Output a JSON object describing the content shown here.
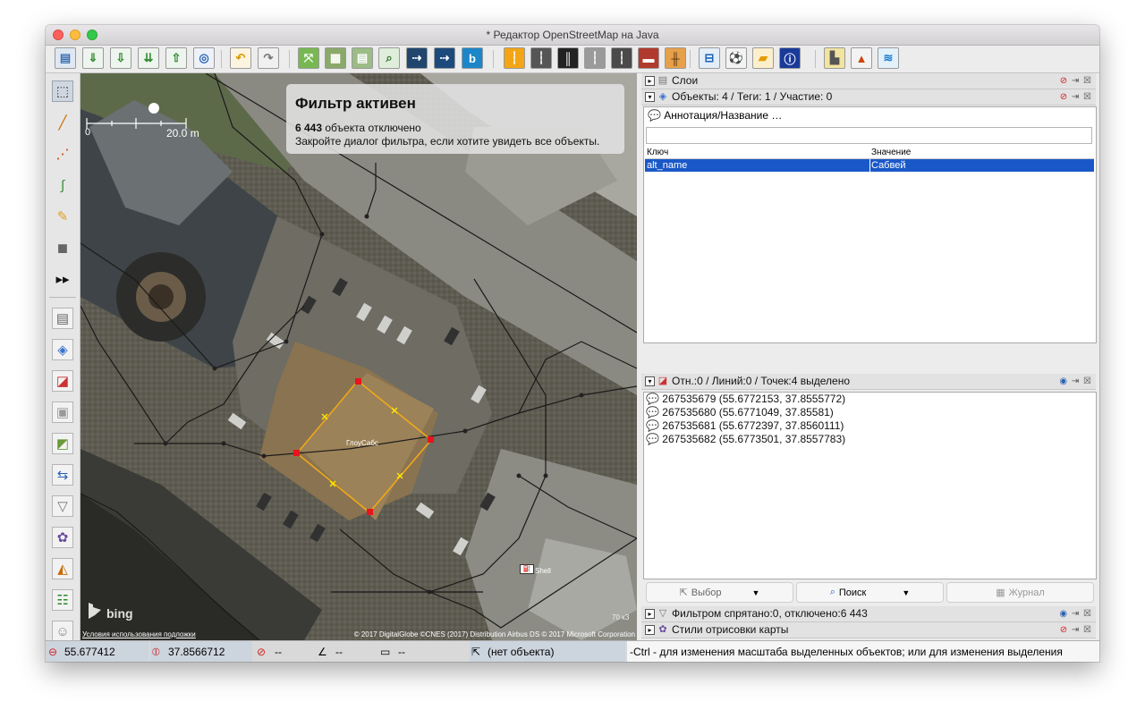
{
  "window": {
    "title": "* Редактор OpenStreetMap на Java"
  },
  "toolbar": {
    "buttons": [
      {
        "icon": "open-file-icon",
        "glyph": "▤",
        "color": "#3b6fb0",
        "bg": "#dfe8f2"
      },
      {
        "icon": "save-icon",
        "glyph": "⇓",
        "color": "#2f8a2f",
        "bg": "#eef4ee"
      },
      {
        "icon": "download-icon",
        "glyph": "⇩",
        "color": "#2f8a2f",
        "bg": "#eef4ee"
      },
      {
        "icon": "download-area-icon",
        "glyph": "⇊",
        "color": "#2f8a2f",
        "bg": "#eef4ee"
      },
      {
        "icon": "upload-icon",
        "glyph": "⇧",
        "color": "#2f8a2f",
        "bg": "#eef4ee"
      },
      {
        "icon": "globe-icon",
        "glyph": "◎",
        "color": "#2a65b8",
        "bg": "#eef2f8"
      },
      {
        "icon": "undo-icon",
        "glyph": "↶",
        "color": "#d89a00",
        "bg": "#fbf4e0"
      },
      {
        "icon": "redo-icon",
        "glyph": "↷",
        "color": "#777777",
        "bg": "#f0f0f0"
      },
      {
        "icon": "zoom-to-selection-icon",
        "glyph": "⤧",
        "color": "#ffffff",
        "bg": "#78b852"
      },
      {
        "icon": "zoom-to-layer-icon",
        "glyph": "▦",
        "color": "#ffffff",
        "bg": "#8aa96a"
      },
      {
        "icon": "wms-icon",
        "glyph": "▤",
        "color": "#ffffff",
        "bg": "#9cbc86"
      },
      {
        "icon": "search-icon",
        "glyph": "⌕",
        "color": "#2f6d2f",
        "bg": "#dfeedb"
      },
      {
        "icon": "layer-motorway-icon",
        "glyph": "⇢",
        "color": "#ffffff",
        "bg": "#20466e"
      },
      {
        "icon": "layer-trunk-icon",
        "glyph": "⇢",
        "color": "#ffffff",
        "bg": "#1d4a7c"
      },
      {
        "icon": "bing-icon",
        "glyph": "b",
        "color": "#ffffff",
        "bg": "#1c86c9"
      },
      {
        "icon": "road-primary-icon",
        "glyph": "┆",
        "color": "#ffffff",
        "bg": "#f3a516"
      },
      {
        "icon": "road-icon",
        "glyph": "┆",
        "color": "#ffffff",
        "bg": "#555555"
      },
      {
        "icon": "road-dual-icon",
        "glyph": "║",
        "color": "#ffffff",
        "bg": "#222222"
      },
      {
        "icon": "road-gray-icon",
        "glyph": "┆",
        "color": "#ffffff",
        "bg": "#9a9a9a"
      },
      {
        "icon": "road-track-icon",
        "glyph": "┆",
        "color": "#ffffff",
        "bg": "#4a4a4a"
      },
      {
        "icon": "wall-icon",
        "glyph": "▬",
        "color": "#ffffff",
        "bg": "#b03a2e"
      },
      {
        "icon": "railway-icon",
        "glyph": "╫",
        "color": "#5a3510",
        "bg": "#e6a04a"
      },
      {
        "icon": "hotel-icon",
        "glyph": "⊟",
        "color": "#1a63b5",
        "bg": "#e4eef8"
      },
      {
        "icon": "sport-icon",
        "glyph": "⚽",
        "color": "#111111",
        "bg": "#f3f3f3"
      },
      {
        "icon": "shop-icon",
        "glyph": "▰",
        "color": "#e39b00",
        "bg": "#fcefcc"
      },
      {
        "icon": "info-icon",
        "glyph": "ⓘ",
        "color": "#ffffff",
        "bg": "#1a3a9a"
      },
      {
        "icon": "industrial-icon",
        "glyph": "▙",
        "color": "#555555",
        "bg": "#f1e4a0"
      },
      {
        "icon": "mountain-icon",
        "glyph": "▲",
        "color": "#d0440a",
        "bg": "#f3f3f3"
      },
      {
        "icon": "water-icon",
        "glyph": "≋",
        "color": "#1c7fd0",
        "bg": "#e3f1fb"
      }
    ]
  },
  "tools": [
    {
      "icon": "select-tool-icon",
      "glyph": "⬚",
      "color": "#333333"
    },
    {
      "icon": "draw-line-icon",
      "glyph": "╱",
      "color": "#cc6a00"
    },
    {
      "icon": "draw-nodes-icon",
      "glyph": "⋰",
      "color": "#cc3a00"
    },
    {
      "icon": "improve-way-icon",
      "glyph": "∫",
      "color": "#3a8a3a"
    },
    {
      "icon": "pencil-icon",
      "glyph": "✎",
      "color": "#e0a020"
    },
    {
      "icon": "building-icon",
      "glyph": "◼",
      "color": "#666666"
    },
    {
      "icon": "more-tools-icon",
      "glyph": "▸▸",
      "color": "#111111"
    },
    {
      "icon": "layers-toggle-icon",
      "glyph": "▤",
      "color": "#666666"
    },
    {
      "icon": "tags-toggle-icon",
      "glyph": "◈",
      "color": "#3a72c8"
    },
    {
      "icon": "selection-toggle-icon",
      "glyph": "◪",
      "color": "#cc3333"
    },
    {
      "icon": "minimap-toggle-icon",
      "glyph": "▣",
      "color": "#999999"
    },
    {
      "icon": "imagery-toggle-icon",
      "glyph": "◩",
      "color": "#6a9a3a"
    },
    {
      "icon": "conflict-toggle-icon",
      "glyph": "⇆",
      "color": "#2a5fb0"
    },
    {
      "icon": "filter-toggle-icon",
      "glyph": "▽",
      "color": "#777777"
    },
    {
      "icon": "map-style-toggle-icon",
      "glyph": "✿",
      "color": "#6a4aa0"
    },
    {
      "icon": "validation-toggle-icon",
      "glyph": "◭",
      "color": "#c86a00"
    },
    {
      "icon": "changeset-toggle-icon",
      "glyph": "☷",
      "color": "#2a8a2a"
    },
    {
      "icon": "preferences-toggle-icon",
      "glyph": "☺",
      "color": "#888888"
    }
  ],
  "map": {
    "scale": {
      "zero": "0",
      "distance": "20.0 m"
    },
    "building_label": "ГлоуСабс",
    "shell_label": "Shell",
    "filter_overlay": {
      "title": "Фильтр активен",
      "count": "6 443",
      "disabled_text": " объекта отключено",
      "hint": "Закройте диалог фильтра, если хотите увидеть все объекты."
    },
    "bing_logo": "bing",
    "terms_link": "Условия использования подложки",
    "copyright": "© 2017 DigitalGlobe ©CNES (2017) Distribution Airbus DS © 2017 Microsoft Corporation",
    "zoom_info": "70 кЗ"
  },
  "panels": {
    "layers": {
      "title": "Слои"
    },
    "properties": {
      "title": "Объекты: 4 / Теги: 1 / Участие: 0",
      "preset": "Аннотация/Название …",
      "key_header": "Ключ",
      "value_header": "Значение",
      "rows": [
        {
          "key": "alt_name",
          "value": "Сабвей"
        }
      ]
    },
    "selection": {
      "title": "Отн.:0 / Линий:0 / Точек:4 выделено",
      "items": [
        "267535679 (55.6772153, 37.8555772)",
        "267535680 (55.6771049, 37.85581)",
        "267535681 (55.6772397, 37.8560111)",
        "267535682 (55.6773501, 37.8557783)"
      ],
      "select_button": "Выбор",
      "search_button": "Поиск",
      "history_button": "Журнал"
    },
    "filter": {
      "title": "Фильтром спрятано:0, отключено:6 443"
    },
    "map_styles": {
      "title": "Стили отрисовки карты"
    }
  },
  "status": {
    "lat": "55.677412",
    "lon": "37.8566712",
    "heading": "--",
    "angle": "--",
    "length": "--",
    "object": "(нет объекта)",
    "help": "-Ctrl - для изменения масштаба выделенных объектов; или для изменения выделения"
  }
}
